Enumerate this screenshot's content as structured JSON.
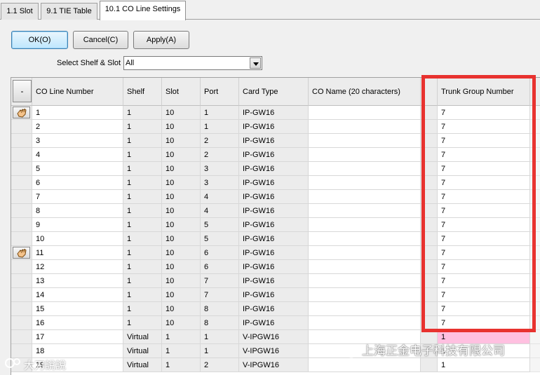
{
  "tabs": [
    {
      "label": "1.1 Slot",
      "active": false
    },
    {
      "label": "9.1 TIE Table",
      "active": false
    },
    {
      "label": "10.1 CO Line Settings",
      "active": true
    }
  ],
  "toolbar": {
    "ok_label": "OK(O)",
    "cancel_label": "Cancel(C)",
    "apply_label": "Apply(A)"
  },
  "filter": {
    "label": "Select Shelf & Slot",
    "value": "All"
  },
  "table": {
    "corner_label": "-",
    "headers": {
      "co_line_number": "CO Line Number",
      "shelf": "Shelf",
      "slot": "Slot",
      "port": "Port",
      "card_type": "Card Type",
      "co_name": "CO Name (20 characters)",
      "trunk_group_number": "Trunk Group Number"
    },
    "rows": [
      {
        "co": "1",
        "shelf": "1",
        "slot": "10",
        "port": "1",
        "card": "IP-GW16",
        "name": "",
        "tgn": "7",
        "icon": true
      },
      {
        "co": "2",
        "shelf": "1",
        "slot": "10",
        "port": "1",
        "card": "IP-GW16",
        "name": "",
        "tgn": "7"
      },
      {
        "co": "3",
        "shelf": "1",
        "slot": "10",
        "port": "2",
        "card": "IP-GW16",
        "name": "",
        "tgn": "7"
      },
      {
        "co": "4",
        "shelf": "1",
        "slot": "10",
        "port": "2",
        "card": "IP-GW16",
        "name": "",
        "tgn": "7"
      },
      {
        "co": "5",
        "shelf": "1",
        "slot": "10",
        "port": "3",
        "card": "IP-GW16",
        "name": "",
        "tgn": "7"
      },
      {
        "co": "6",
        "shelf": "1",
        "slot": "10",
        "port": "3",
        "card": "IP-GW16",
        "name": "",
        "tgn": "7"
      },
      {
        "co": "7",
        "shelf": "1",
        "slot": "10",
        "port": "4",
        "card": "IP-GW16",
        "name": "",
        "tgn": "7"
      },
      {
        "co": "8",
        "shelf": "1",
        "slot": "10",
        "port": "4",
        "card": "IP-GW16",
        "name": "",
        "tgn": "7"
      },
      {
        "co": "9",
        "shelf": "1",
        "slot": "10",
        "port": "5",
        "card": "IP-GW16",
        "name": "",
        "tgn": "7"
      },
      {
        "co": "10",
        "shelf": "1",
        "slot": "10",
        "port": "5",
        "card": "IP-GW16",
        "name": "",
        "tgn": "7"
      },
      {
        "co": "11",
        "shelf": "1",
        "slot": "10",
        "port": "6",
        "card": "IP-GW16",
        "name": "",
        "tgn": "7",
        "icon": true
      },
      {
        "co": "12",
        "shelf": "1",
        "slot": "10",
        "port": "6",
        "card": "IP-GW16",
        "name": "",
        "tgn": "7"
      },
      {
        "co": "13",
        "shelf": "1",
        "slot": "10",
        "port": "7",
        "card": "IP-GW16",
        "name": "",
        "tgn": "7"
      },
      {
        "co": "14",
        "shelf": "1",
        "slot": "10",
        "port": "7",
        "card": "IP-GW16",
        "name": "",
        "tgn": "7"
      },
      {
        "co": "15",
        "shelf": "1",
        "slot": "10",
        "port": "8",
        "card": "IP-GW16",
        "name": "",
        "tgn": "7"
      },
      {
        "co": "16",
        "shelf": "1",
        "slot": "10",
        "port": "8",
        "card": "IP-GW16",
        "name": "",
        "tgn": "7"
      },
      {
        "co": "17",
        "shelf": "Virtual",
        "slot": "1",
        "port": "1",
        "card": "V-IPGW16",
        "name": "",
        "tgn": "1",
        "pink": true
      },
      {
        "co": "18",
        "shelf": "Virtual",
        "slot": "1",
        "port": "1",
        "card": "V-IPGW16",
        "name": "",
        "tgn": "1"
      },
      {
        "co": "19",
        "shelf": "Virtual",
        "slot": "1",
        "port": "2",
        "card": "V-IPGW16",
        "name": "",
        "tgn": "1"
      }
    ]
  },
  "watermarks": {
    "right": "上海正金电子科技有限公司",
    "left": "大刀說說"
  },
  "colors": {
    "highlight": "#e8322f",
    "pink_cell": "#ffc0e0",
    "button_accent": "#3c7fb1"
  }
}
